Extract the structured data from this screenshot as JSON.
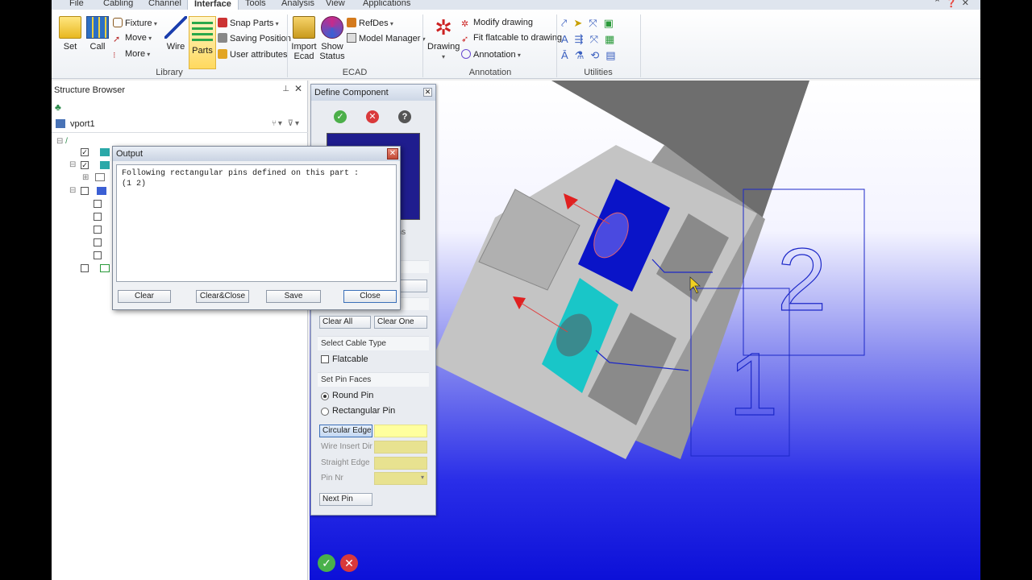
{
  "ribbon_tabs": [
    "File",
    "Cabling",
    "Channel",
    "Interface",
    "Tools",
    "Analysis",
    "View",
    "Applications"
  ],
  "active_tab": "Interface",
  "library_group": {
    "label": "Library",
    "set": "Set",
    "call": "Call",
    "fixture": "Fixture",
    "move": "Move",
    "more": "More",
    "wire": "Wire",
    "parts": "Parts",
    "snap_parts": "Snap Parts",
    "saving_position": "Saving Position",
    "user_attributes": "User attributes"
  },
  "ecad_group": {
    "label": "ECAD",
    "import_ecad_1": "Import",
    "import_ecad_2": "Ecad",
    "show_status_1": "Show",
    "show_status_2": "Status",
    "refdes": "RefDes",
    "model_manager": "Model Manager"
  },
  "annotation_group": {
    "label": "Annotation",
    "drawing": "Drawing",
    "modify_drawing": "Modify drawing",
    "fit_flatcable": "Fit flatcable to drawing",
    "annotation": "Annotation"
  },
  "utilities_group": {
    "label": "Utilities"
  },
  "structure_browser": {
    "title": "Structure Browser",
    "vport": "vport1"
  },
  "define_component": {
    "title": "Define Component",
    "options_fragment": "tions",
    "clear_all": "Clear All",
    "clear_one": "Clear One",
    "select_cable_type": "Select Cable Type",
    "flatcable": "Flatcable",
    "set_pin_faces": "Set Pin Faces",
    "round_pin": "Round Pin",
    "rectangular_pin": "Rectangular Pin",
    "selected_pin_type": "Round Pin",
    "circular_edge": "Circular Edge",
    "wire_insert_dir": "Wire Insert Dir",
    "straight_edge": "Straight Edge",
    "pin_nr": "Pin Nr",
    "next_pin": "Next Pin"
  },
  "output_dialog": {
    "title": "Output",
    "line1": "Following rectangular pins defined on this part :",
    "line2": "(1 2)",
    "clear": "Clear",
    "clear_close": "Clear&Close",
    "save": "Save",
    "close": "Close"
  },
  "viewport": {
    "pin_labels": [
      "2",
      "1"
    ]
  },
  "colors": {
    "ribbon_bg": "#eef1f5",
    "viewport_blue": "#0c10d8",
    "pin_face_blue": "#0a14c8",
    "pin_face_cyan": "#19c6c8",
    "highlight_yellow": "#ffd95e"
  }
}
